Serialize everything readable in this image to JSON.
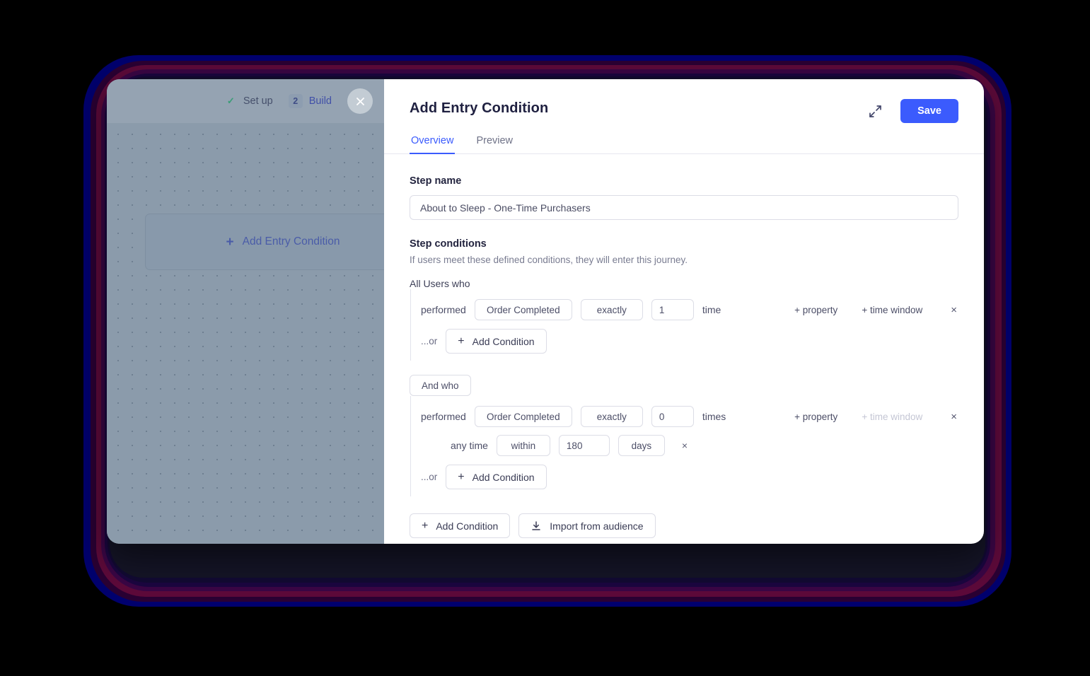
{
  "canvas": {
    "stepper": [
      {
        "icon": "check-icon",
        "label": "Set up",
        "state": "done"
      },
      {
        "number": "2",
        "label": "Build",
        "state": "active"
      }
    ],
    "close_label": "×",
    "entry_card": {
      "plus": "+",
      "label": "Add Entry Condition"
    }
  },
  "panel": {
    "title": "Add Entry Condition",
    "expand_icon": "expand-diagonal-icon",
    "save_label": "Save",
    "tabs": [
      {
        "label": "Overview",
        "active": true
      },
      {
        "label": "Preview",
        "active": false
      }
    ],
    "step_name": {
      "label": "Step name",
      "value": "About to Sleep - One-Time Purchasers",
      "placeholder": "Step name"
    },
    "step_conditions": {
      "label": "Step conditions",
      "description": "If users meet these defined conditions, they will enter this journey.",
      "all_users_label": "All Users who",
      "and_who_label": "And who",
      "groups": [
        {
          "rows": [
            {
              "prefix": "performed",
              "event": "Order Completed",
              "operator": "exactly",
              "count": "1",
              "unit": "time",
              "add_property": "+ property",
              "add_time_window": "+ time window",
              "time_window_disabled": false,
              "remove": "×"
            }
          ],
          "or_label": "...or",
          "add_condition_label": "Add Condition"
        },
        {
          "rows": [
            {
              "prefix": "performed",
              "event": "Order Completed",
              "operator": "exactly",
              "count": "0",
              "unit": "times",
              "add_property": "+ property",
              "add_time_window": "+ time window",
              "time_window_disabled": true,
              "remove": "×"
            }
          ],
          "time_row": {
            "prefix": "any time",
            "operator": "within",
            "amount": "180",
            "unit": "days",
            "remove": "×"
          },
          "or_label": "...or",
          "add_condition_label": "Add Condition"
        }
      ]
    },
    "bottom_actions": {
      "add_condition_label": "Add Condition",
      "import_label": "Import from audience",
      "import_icon": "download-icon",
      "plus_icon": "plus-icon"
    }
  },
  "colors": {
    "accent": "#3b5bfd",
    "panel_bg": "#ffffff",
    "canvas_bg": "#8b9bab",
    "border": "#dcdde6",
    "text_primary": "#23243f",
    "text_muted": "#797c91",
    "check_green": "#3a9d76",
    "glow_blue": "#00006e",
    "glow_magenta": "#5d0a3a",
    "glow_purple": "#3a0645"
  }
}
